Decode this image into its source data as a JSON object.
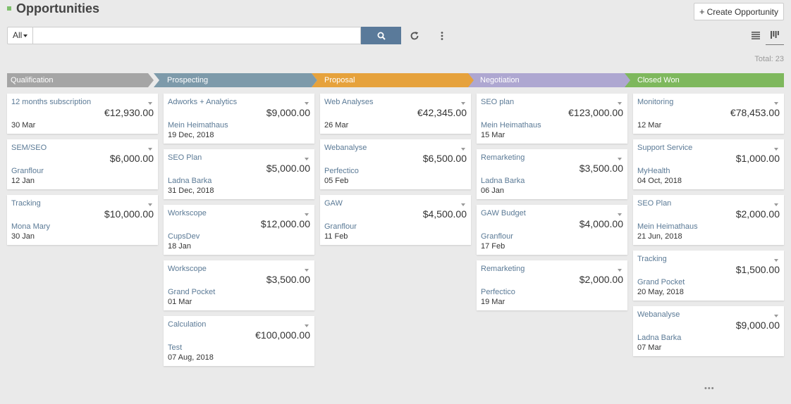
{
  "header": {
    "title": "Opportunities",
    "create_label": "Create Opportunity"
  },
  "search": {
    "filter_label": "All",
    "placeholder": "",
    "value": ""
  },
  "total": "Total: 23",
  "stages": [
    {
      "label": "Qualification",
      "color": "#a5a5a5"
    },
    {
      "label": "Prospecting",
      "color": "#7d9aaa"
    },
    {
      "label": "Proposal",
      "color": "#e6a23c"
    },
    {
      "label": "Negotiation",
      "color": "#aea7d1"
    },
    {
      "label": "Closed Won",
      "color": "#7eb85d"
    }
  ],
  "columns": [
    {
      "cards": [
        {
          "name": "12 months subscription",
          "amount": "€12,930.00",
          "account": "",
          "date": "30 Mar"
        },
        {
          "name": "SEM/SEO",
          "amount": "$6,000.00",
          "account": "Granflour",
          "date": "12 Jan"
        },
        {
          "name": "Tracking",
          "amount": "$10,000.00",
          "account": "Mona Mary",
          "date": "30 Jan"
        }
      ]
    },
    {
      "cards": [
        {
          "name": "Adworks + Analytics",
          "amount": "$9,000.00",
          "account": "Mein Heimathaus",
          "date": "19 Dec, 2018"
        },
        {
          "name": "SEO Plan",
          "amount": "$5,000.00",
          "account": "Ladna Barka",
          "date": "31 Dec, 2018"
        },
        {
          "name": "Workscope",
          "amount": "$12,000.00",
          "account": "CupsDev",
          "date": "18 Jan"
        },
        {
          "name": "Workscope",
          "amount": "$3,500.00",
          "account": "Grand Pocket",
          "date": "01 Mar"
        },
        {
          "name": "Calculation",
          "amount": "€100,000.00",
          "account": "Test",
          "date": "07 Aug, 2018"
        }
      ]
    },
    {
      "cards": [
        {
          "name": "Web Analyses",
          "amount": "€42,345.00",
          "account": "",
          "date": "26 Mar"
        },
        {
          "name": "Webanalyse",
          "amount": "$6,500.00",
          "account": "Perfectico",
          "date": "05 Feb"
        },
        {
          "name": "GAW",
          "amount": "$4,500.00",
          "account": "Granflour",
          "date": "11 Feb"
        }
      ]
    },
    {
      "cards": [
        {
          "name": "SEO plan",
          "amount": "€123,000.00",
          "account": "Mein Heimathaus",
          "date": "15 Mar"
        },
        {
          "name": "Remarketing",
          "amount": "$3,500.00",
          "account": "Ladna Barka",
          "date": "06 Jan"
        },
        {
          "name": "GAW Budget",
          "amount": "$4,000.00",
          "account": "Granflour",
          "date": "17 Feb"
        },
        {
          "name": "Remarketing",
          "amount": "$2,000.00",
          "account": "Perfectico",
          "date": "19 Mar"
        }
      ]
    },
    {
      "cards": [
        {
          "name": "Monitoring",
          "amount": "€78,453.00",
          "account": "",
          "date": "12 Mar"
        },
        {
          "name": "Support Service",
          "amount": "$1,000.00",
          "account": "MyHealth",
          "date": "04 Oct, 2018"
        },
        {
          "name": "SEO Plan",
          "amount": "$2,000.00",
          "account": "Mein Heimathaus",
          "date": "21 Jun, 2018"
        },
        {
          "name": "Tracking",
          "amount": "$1,500.00",
          "account": "Grand Pocket",
          "date": "20 May, 2018"
        },
        {
          "name": "Webanalyse",
          "amount": "$9,000.00",
          "account": "Ladna Barka",
          "date": "07 Mar"
        }
      ]
    }
  ],
  "more_label": "•••",
  "icons": {
    "search": "search-icon",
    "refresh": "refresh-icon",
    "more": "kebab-menu-icon",
    "list_view": "list-view-icon",
    "kanban_view": "kanban-view-icon"
  }
}
